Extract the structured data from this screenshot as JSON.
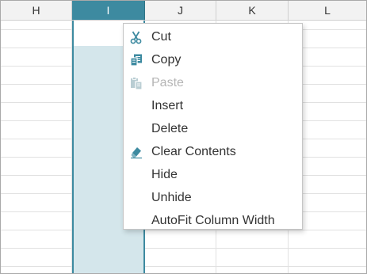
{
  "columns": [
    {
      "label": "H",
      "selected": false
    },
    {
      "label": "I",
      "selected": true
    },
    {
      "label": "J",
      "selected": false
    },
    {
      "label": "K",
      "selected": false
    },
    {
      "label": "L",
      "selected": false
    }
  ],
  "context_menu": {
    "items": [
      {
        "label": "Cut",
        "icon": "scissors-icon",
        "enabled": true
      },
      {
        "label": "Copy",
        "icon": "copy-icon",
        "enabled": true
      },
      {
        "label": "Paste",
        "icon": "paste-icon",
        "enabled": false
      },
      {
        "label": "Insert",
        "icon": null,
        "enabled": true
      },
      {
        "label": "Delete",
        "icon": null,
        "enabled": true
      },
      {
        "label": "Clear Contents",
        "icon": "eraser-icon",
        "enabled": true
      },
      {
        "label": "Hide",
        "icon": null,
        "enabled": true
      },
      {
        "label": "Unhide",
        "icon": null,
        "enabled": true
      },
      {
        "label": "AutoFit Column Width",
        "icon": null,
        "enabled": true
      }
    ]
  },
  "colors": {
    "accent": "#3d8aa0",
    "selection_fill": "#d4e6eb",
    "header_bg": "#f2f2f2",
    "gridline": "#e1e1e1"
  }
}
